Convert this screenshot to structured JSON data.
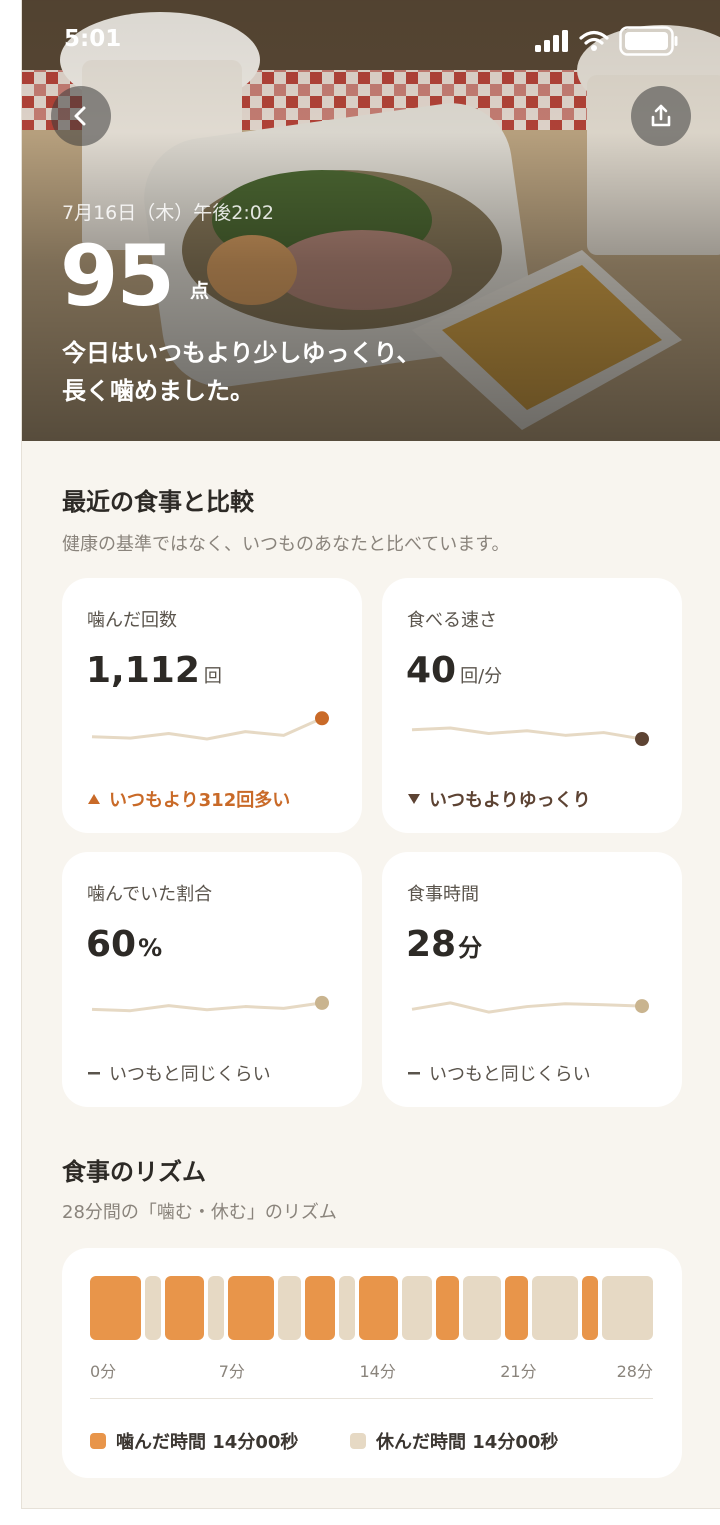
{
  "status_bar": {
    "time": "5:01"
  },
  "header": {
    "date": "7月16日（木）午後2:02",
    "score": "95",
    "score_unit": "点",
    "message_line1": "今日はいつもより少しゆっくり、",
    "message_line2": "長く噛めました。"
  },
  "icons": {
    "back": "chevron-left-icon",
    "share": "share-icon",
    "signal": "signal-icon",
    "wifi": "wifi-icon",
    "battery": "battery-icon"
  },
  "comparison": {
    "title": "最近の食事と比較",
    "subtitle": "健康の基準ではなく、いつものあなたと比べています。",
    "cards": [
      {
        "label": "噛んだ回数",
        "value": "1,112",
        "unit": "回",
        "trend": "いつもより312回多い",
        "trend_dir": "up",
        "spark": [
          0.55,
          0.52,
          0.62,
          0.5,
          0.66,
          0.58,
          0.95
        ],
        "accent": "#c96a28"
      },
      {
        "label": "食べる速さ",
        "value": "40",
        "unit": "回/分",
        "trend": "いつもよりゆっくり",
        "trend_dir": "down",
        "spark": [
          0.7,
          0.74,
          0.62,
          0.68,
          0.58,
          0.64,
          0.5
        ],
        "accent": "#5d4333"
      },
      {
        "label": "噛んでいた割合",
        "value": "60",
        "unit": "%",
        "trend": "いつもと同じくらい",
        "trend_dir": "same",
        "spark": [
          0.58,
          0.55,
          0.66,
          0.57,
          0.64,
          0.6,
          0.72
        ],
        "accent": "#c9b48f"
      },
      {
        "label": "食事時間",
        "value": "28",
        "unit": "分",
        "trend": "いつもと同じくらい",
        "trend_dir": "same",
        "spark": [
          0.58,
          0.72,
          0.52,
          0.64,
          0.7,
          0.68,
          0.65
        ],
        "accent": "#c9b48f"
      }
    ]
  },
  "rhythm": {
    "title": "食事のリズム",
    "subtitle": "28分間の「噛む・休む」のリズム",
    "total_minutes": 28,
    "segments": [
      {
        "type": "chew",
        "minutes": 2.9
      },
      {
        "type": "rest",
        "minutes": 0.9
      },
      {
        "type": "chew",
        "minutes": 2.2
      },
      {
        "type": "rest",
        "minutes": 0.9
      },
      {
        "type": "chew",
        "minutes": 2.6
      },
      {
        "type": "rest",
        "minutes": 1.3
      },
      {
        "type": "chew",
        "minutes": 1.7
      },
      {
        "type": "rest",
        "minutes": 0.9
      },
      {
        "type": "chew",
        "minutes": 2.2
      },
      {
        "type": "rest",
        "minutes": 1.7
      },
      {
        "type": "chew",
        "minutes": 1.3
      },
      {
        "type": "rest",
        "minutes": 2.1
      },
      {
        "type": "chew",
        "minutes": 1.3
      },
      {
        "type": "rest",
        "minutes": 2.6
      },
      {
        "type": "chew",
        "minutes": 0.9
      },
      {
        "type": "rest",
        "minutes": 2.9
      }
    ],
    "axis_ticks": [
      {
        "label": "0分",
        "minute": 0
      },
      {
        "label": "7分",
        "minute": 7
      },
      {
        "label": "14分",
        "minute": 14
      },
      {
        "label": "21分",
        "minute": 21
      },
      {
        "label": "28分",
        "minute": 28
      }
    ],
    "legend": {
      "chew": "噛んだ時間 14分00秒",
      "rest": "休んだ時間 14分00秒"
    },
    "colors": {
      "chew": "#e8954a",
      "rest": "#e6d9c4"
    }
  }
}
